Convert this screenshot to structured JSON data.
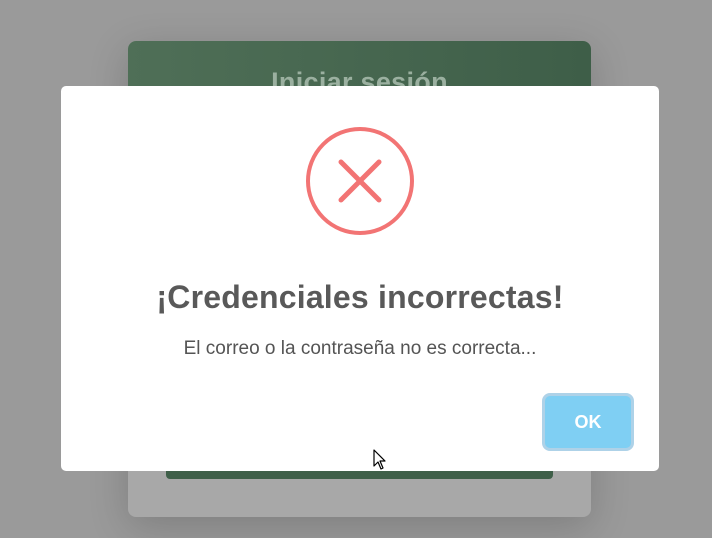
{
  "background": {
    "login_title": "Iniciar sesión"
  },
  "dialog": {
    "icon": "error-x-circle-icon",
    "title": "¡Credenciales incorrectas!",
    "message": "El correo o la contraseña no es correcta...",
    "confirm_label": "OK"
  },
  "colors": {
    "overlay": "#9a9a9a",
    "login_header": "#4f6f57",
    "error_icon": "#f27474",
    "confirm_button": "#7fcff3",
    "title_text": "#595959"
  }
}
